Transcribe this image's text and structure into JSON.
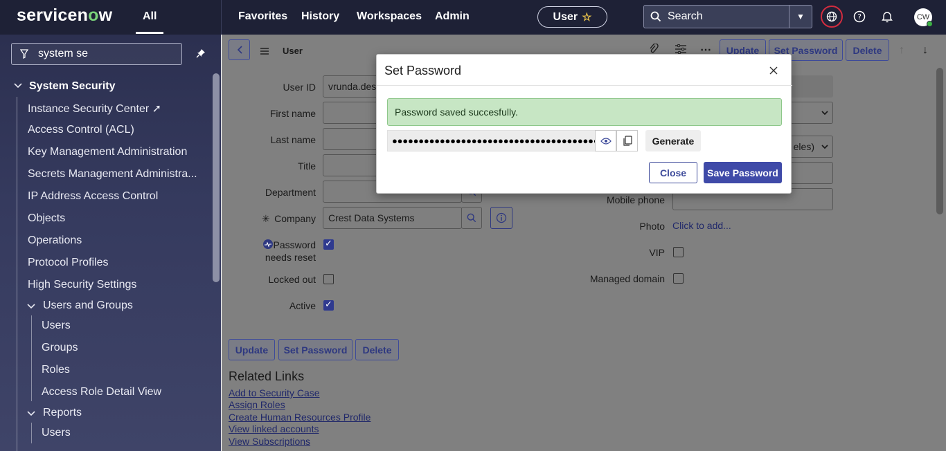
{
  "header": {
    "logo_text_a": "servicen",
    "logo_text_o": "o",
    "logo_text_b": "w",
    "all_tab": "All",
    "nav": [
      "Favorites",
      "History",
      "Workspaces",
      "Admin"
    ],
    "user_pill": "User",
    "search_label": "Search",
    "avatar_initials": "CW"
  },
  "sidebar": {
    "filter_value": "system se",
    "section_title": "System Security",
    "items": [
      "Instance Security Center",
      "Access Control (ACL)",
      "Key Management Administration",
      "Secrets Management Administra...",
      "IP Address Access Control",
      "Objects",
      "Operations",
      "Protocol Profiles",
      "High Security Settings"
    ],
    "users_groups_title": "Users and Groups",
    "users_groups_items": [
      "Users",
      "Groups",
      "Roles",
      "Access Role Detail View"
    ],
    "reports_title": "Reports",
    "reports_items": [
      "Users"
    ]
  },
  "form": {
    "title": "User",
    "header_buttons": [
      "Update",
      "Set Password",
      "Delete"
    ],
    "labels": {
      "user_id": "User ID",
      "first_name": "First name",
      "last_name": "Last name",
      "title": "Title",
      "department": "Department",
      "company": "Company",
      "password_reset_1": "Password",
      "password_reset_2": "needs reset",
      "locked_out": "Locked out",
      "active": "Active",
      "mobile_phone": "Mobile phone",
      "photo": "Photo",
      "vip": "VIP",
      "managed_domain": "Managed domain"
    },
    "values": {
      "user_id": "vrunda.desa",
      "company": "Crest Data Systems",
      "photo_link": "Click to add...",
      "select_partial": "eles)"
    },
    "checkboxes": {
      "password_needs_reset": true,
      "locked_out": false,
      "active": true,
      "vip": false,
      "managed_domain": false
    },
    "bottom_buttons": [
      "Update",
      "Set Password",
      "Delete"
    ],
    "related_links_title": "Related Links",
    "related_links": [
      "Add to Security Case",
      "Assign Roles",
      "Create Human Resources Profile",
      "View linked accounts",
      "View Subscriptions"
    ]
  },
  "dialog": {
    "title": "Set Password",
    "alert": "Password saved succesfully.",
    "password_mask": "●●●●●●●●●●●●●●●●●●●●●●●●●●●●●●●●●●●●●●●●",
    "generate_label": "Generate",
    "close_label": "Close",
    "save_label": "Save Password"
  },
  "colors": {
    "header_bg": "#1e2136",
    "accent": "#3f4aa8",
    "success_bg": "#c7e6c4",
    "alert_ring": "#d22c3f"
  }
}
